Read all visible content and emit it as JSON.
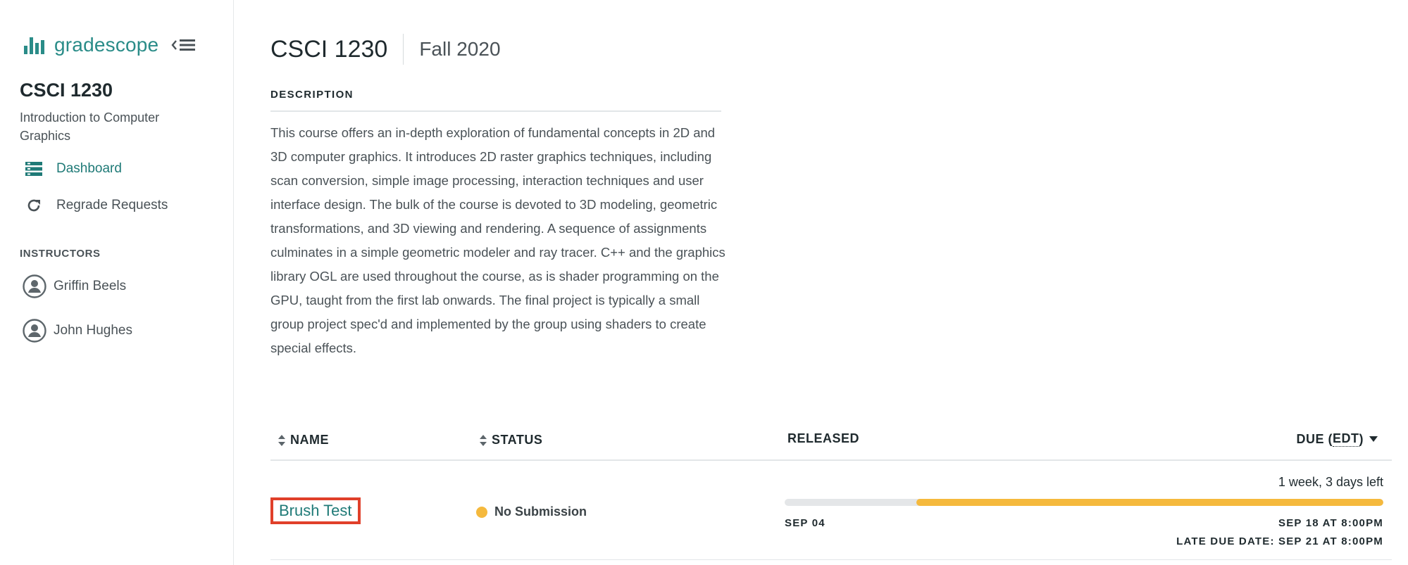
{
  "sidebar": {
    "logo_text": "gradescope",
    "course_code": "CSCI 1230",
    "course_name": "Introduction to Computer Graphics",
    "nav": [
      {
        "label": "Dashboard",
        "icon": "dashboard-icon",
        "active": true
      },
      {
        "label": "Regrade Requests",
        "icon": "refresh-icon",
        "active": false
      }
    ],
    "instructors_heading": "INSTRUCTORS",
    "instructors": [
      "Griffin Beels",
      "John Hughes"
    ]
  },
  "header": {
    "course_code": "CSCI 1230",
    "term": "Fall 2020"
  },
  "description": {
    "heading": "DESCRIPTION",
    "text": "This course offers an in-depth exploration of fundamental concepts in 2D and 3D computer graphics. It introduces 2D raster graphics techniques, including scan conversion, simple image processing, interaction techniques and user interface design. The bulk of the course is devoted to 3D modeling, geometric transformations, and 3D viewing and rendering. A sequence of assignments culminates in a simple geometric modeler and ray tracer. C++ and the graphics library OGL are used throughout the course, as is shader programming on the GPU, taught from the first lab onwards. The final project is typically a small group project spec'd and implemented by the group using shaders to create special effects."
  },
  "table": {
    "columns": {
      "name": "NAME",
      "status": "STATUS",
      "released": "RELEASED",
      "due_prefix": "DUE (",
      "due_tz": "EDT",
      "due_suffix": ")"
    },
    "rows": [
      {
        "name": "Brush Test",
        "status": "No Submission",
        "time_left": "1 week, 3 days left",
        "released": "SEP 04",
        "due": "SEP 18 AT 8:00PM",
        "late_due": "LATE DUE DATE: SEP 21 AT 8:00PM",
        "progress_remaining_fraction": 0.78
      }
    ]
  },
  "colors": {
    "brand": "#2a8c88",
    "status_pending": "#f5b93d",
    "highlight_border": "#e0402a"
  }
}
